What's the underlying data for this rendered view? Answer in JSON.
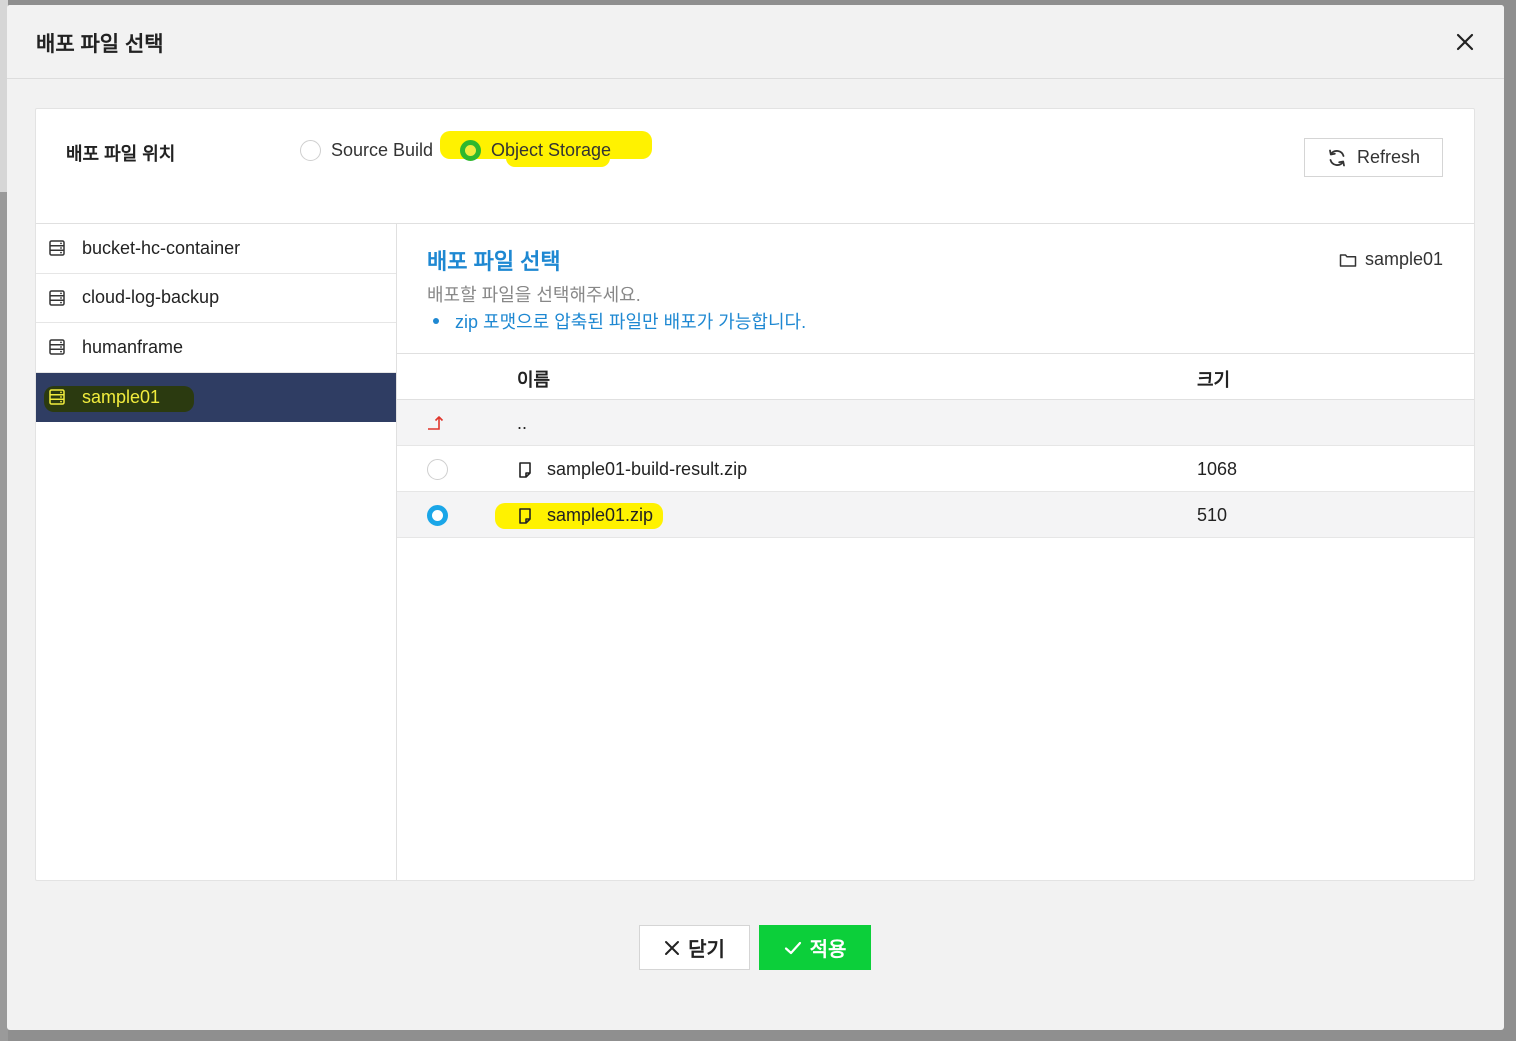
{
  "modal": {
    "title": "배포 파일 선택"
  },
  "location": {
    "label": "배포 파일 위치",
    "options": [
      {
        "label": "Source Build",
        "selected": false
      },
      {
        "label": "Object Storage",
        "selected": true
      }
    ],
    "refresh_label": "Refresh"
  },
  "buckets": [
    {
      "name": "bucket-hc-container",
      "active": false
    },
    {
      "name": "cloud-log-backup",
      "active": false
    },
    {
      "name": "humanframe",
      "active": false
    },
    {
      "name": "sample01",
      "active": true
    }
  ],
  "files": {
    "title": "배포 파일 선택",
    "description": "배포할 파일을 선택해주세요.",
    "note": "zip 포맷으로 압축된 파일만 배포가 가능합니다.",
    "current_path": "sample01",
    "columns": {
      "name": "이름",
      "size": "크기"
    },
    "parent_row": "..",
    "rows": [
      {
        "name": "sample01-build-result.zip",
        "size": "1068",
        "selected": false
      },
      {
        "name": "sample01.zip",
        "size": "510",
        "selected": true
      }
    ]
  },
  "footer": {
    "close_label": "닫기",
    "apply_label": "적용"
  },
  "colors": {
    "accent_blue": "#1e88d2",
    "apply_green": "#0ccf3a",
    "active_bucket_bg": "#2f3d63",
    "highlight_yellow": "#fff200"
  }
}
